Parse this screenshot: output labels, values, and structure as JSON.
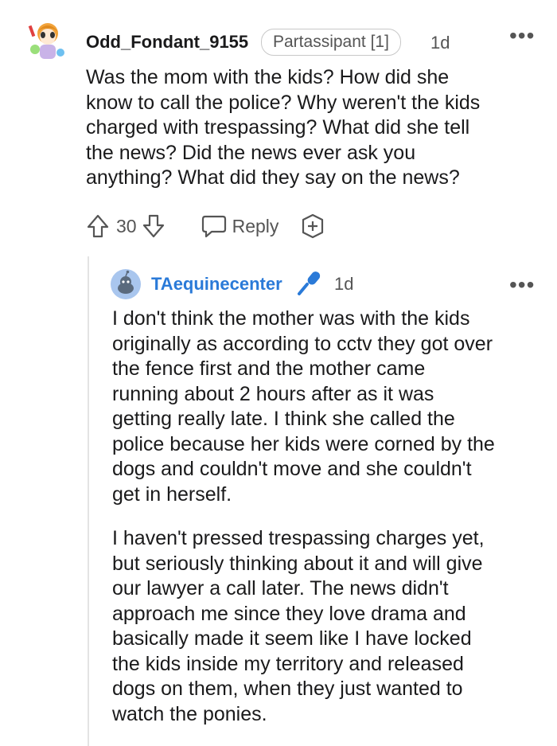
{
  "comment": {
    "username": "Odd_Fondant_9155",
    "flair": "Partassipant [1]",
    "time": "1d",
    "text": "Was the mom with the kids? How did she\nknow to call the police? Why weren't the kids\ncharged with trespassing? What did she tell\nthe news? Did the news ever ask you\nanything? What did they say on the news?",
    "votes": "30",
    "reply_label": "Reply"
  },
  "reply": {
    "username": "TAequinecenter",
    "time": "1d",
    "paragraph1": "I don't think the mother was with the kids\noriginally as according to cctv they got over\nthe fence first and the mother came\nrunning about 2 hours after as it was\ngetting really late. I think she called the\npolice because her kids were corned by the\ndogs and couldn't move and she couldn't\nget in herself.",
    "paragraph2": "I haven't pressed trespassing charges yet,\nbut seriously thinking about it and will give\nour lawyer a call later. The news didn't\napproach me since they love drama and\nbasically made it seem like I have locked\nthe kids inside my territory and released\ndogs on them, when they just wanted to\nwatch the ponies."
  },
  "icons": {
    "more": "more-options-icon",
    "upvote": "upvote-icon",
    "downvote": "downvote-icon",
    "reply": "reply-icon",
    "award": "award-icon",
    "mic": "microphone-icon"
  },
  "colors": {
    "op_name": "#2a7ad8",
    "mic": "#2a7ad8"
  }
}
